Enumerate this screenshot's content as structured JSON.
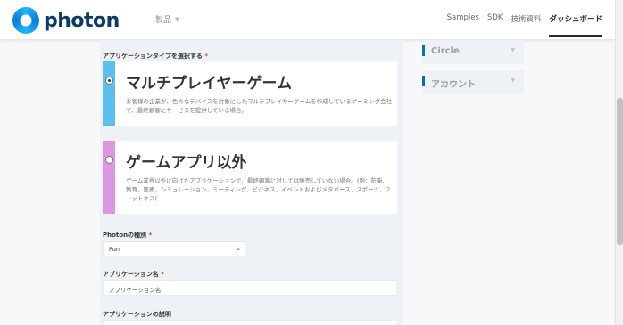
{
  "header": {
    "logo_text": "photon",
    "nav_products": "製品",
    "nav_links": [
      "Samples",
      "SDK",
      "技術資料",
      "ダッシュボード"
    ]
  },
  "form": {
    "app_type_label": "アプリケーションタイプを選択する",
    "required_mark": "*",
    "options": [
      {
        "title": "マルチプレイヤーゲーム",
        "description": "お客様の企業が、色々なデバイスを対象にしたマルチプレイヤーゲームを作成しているゲーミング会社で、最終顧客にサービスを提供している場合。",
        "selected": true,
        "color": "#5bc0f0"
      },
      {
        "title": "ゲームアプリ以外",
        "description": "ゲーム業界以外に向けたアプリケーションで、最終顧客に対しては販売していない場合。(例：防衛、教育、医療、シミュレーション、ミーティング、ビジネス、イベントおよびメタバース、スポーツ、フィットネス)",
        "selected": false,
        "color": "#dc96e4"
      }
    ],
    "photon_type_label": "Photonの種別",
    "photon_type_value": "Pun",
    "app_name_label": "アプリケーション名",
    "app_name_placeholder": "アプリケーション名",
    "app_desc_label": "アプリケーションの説明"
  },
  "sidebar": {
    "items": [
      {
        "label": "Circle"
      },
      {
        "label": "アカウント"
      }
    ]
  }
}
